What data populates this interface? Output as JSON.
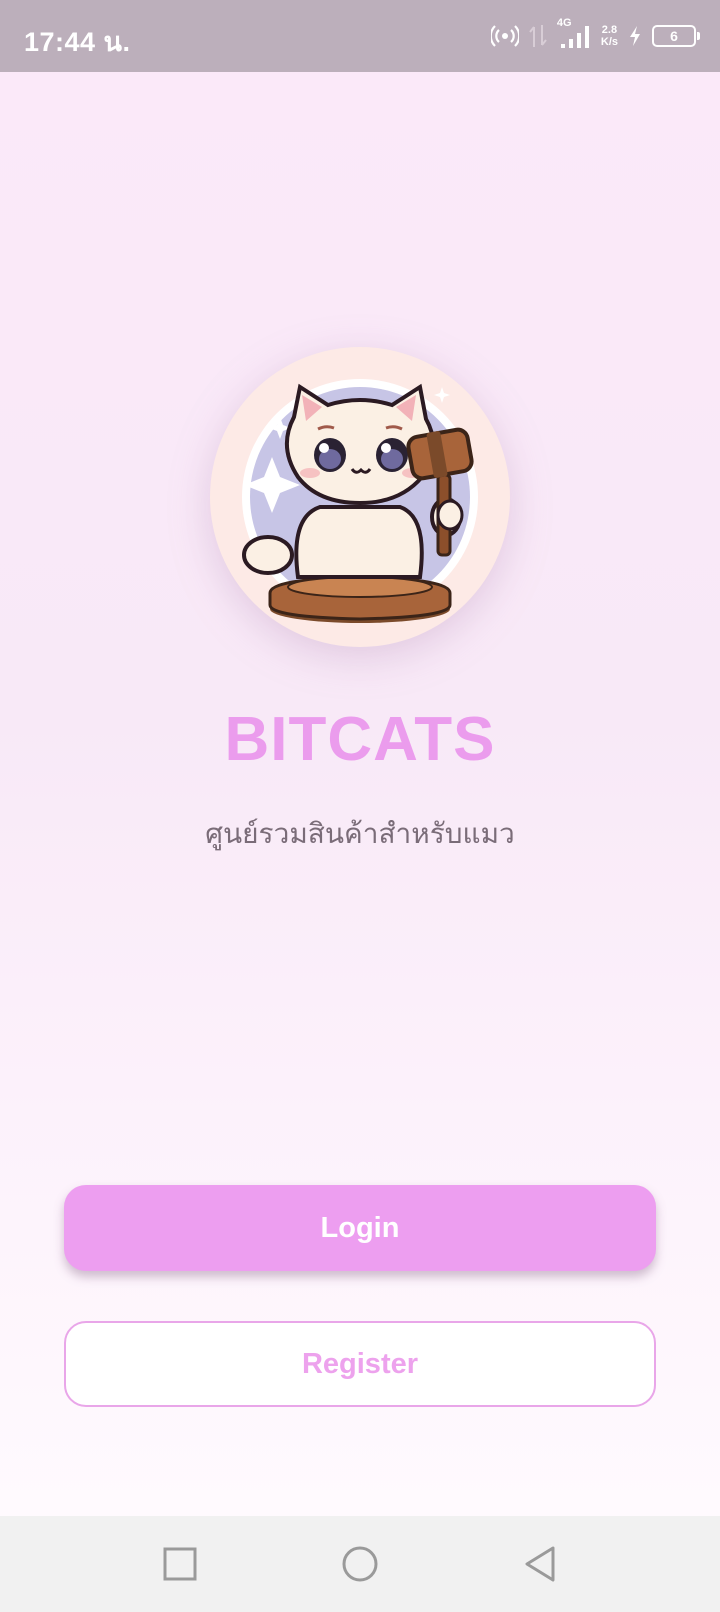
{
  "status_bar": {
    "time": "17:44 น.",
    "network_type": "4G",
    "speed_value": "2.8",
    "speed_unit": "K/s",
    "battery_level": "6",
    "icons": [
      "hotspot-icon",
      "data-arrows-icon",
      "signal-icon",
      "charging-icon",
      "battery-icon"
    ]
  },
  "app": {
    "title": "BITCATS",
    "subtitle": "ศูนย์รวมสินค้าสำหรับแมว",
    "logo_icon": "cat-gavel-logo"
  },
  "buttons": {
    "login_label": "Login",
    "register_label": "Register"
  },
  "nav_bar": {
    "icons": [
      "recents-square-icon",
      "home-circle-icon",
      "back-triangle-icon"
    ]
  },
  "colors": {
    "accent": "#ed9ef0",
    "title": "#eb9ced",
    "status_bar": "#bcafbb",
    "background_top": "#fbe9f9",
    "subtitle_text": "#7a6c78"
  }
}
